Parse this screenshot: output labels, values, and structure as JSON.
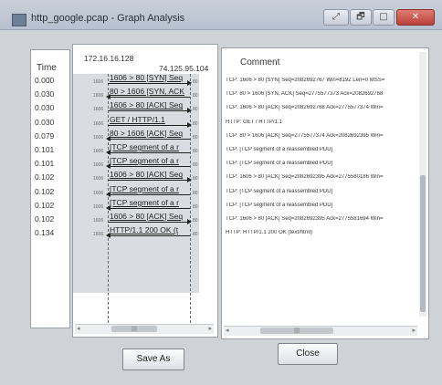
{
  "window": {
    "title": "http_google.pcap - Graph Analysis",
    "controls": [
      "⤢",
      "🗗",
      "□",
      "✕"
    ]
  },
  "time_panel": {
    "header": "Time",
    "times": [
      "0.000",
      "0.030",
      "0.030",
      "0.030",
      "0.079",
      "0.101",
      "0.101",
      "0.102",
      "0.102",
      "0.102",
      "0.102",
      "0.134"
    ]
  },
  "graph_panel": {
    "host_a": "172.16.16.128",
    "host_b": "74.125.95.104",
    "arrows": [
      {
        "label": "1606 > 80 [SYN] Seq",
        "dir": "right",
        "port_a": "1606",
        "port_b": "80"
      },
      {
        "label": "80 > 1606 [SYN, ACK",
        "dir": "left",
        "port_a": "1606",
        "port_b": "80"
      },
      {
        "label": "1606 > 80 [ACK] Seq",
        "dir": "right",
        "port_a": "1606",
        "port_b": "80"
      },
      {
        "label": "GET / HTTP/1.1",
        "dir": "right",
        "port_a": "1606",
        "port_b": "80"
      },
      {
        "label": "80 > 1606 [ACK] Seq",
        "dir": "left",
        "port_a": "1606",
        "port_b": "80"
      },
      {
        "label": "[TCP segment of a r",
        "dir": "left",
        "port_a": "1606",
        "port_b": "80"
      },
      {
        "label": "[TCP segment of a r",
        "dir": "left",
        "port_a": "1606",
        "port_b": "80"
      },
      {
        "label": "1606 > 80 [ACK] Seq",
        "dir": "right",
        "port_a": "1606",
        "port_b": "80"
      },
      {
        "label": "[TCP segment of a r",
        "dir": "left",
        "port_a": "1606",
        "port_b": "80"
      },
      {
        "label": "[TCP segment of a r",
        "dir": "left",
        "port_a": "1606",
        "port_b": "80"
      },
      {
        "label": "1606 > 80 [ACK] Seq",
        "dir": "right",
        "port_a": "1606",
        "port_b": "80"
      },
      {
        "label": "HTTP/1.1 200 OK (t",
        "dir": "left",
        "port_a": "1606",
        "port_b": "80"
      }
    ],
    "scroll_arrows": [
      "◂",
      "▸"
    ],
    "scroll_grip": "|||"
  },
  "comment_panel": {
    "header": "Comment",
    "comments": [
      "TCP: 1606 > 80 [SYN] Seq=2082692767 Win=8192 Len=0 MSS=",
      "TCP: 80 > 1606 [SYN, ACK] Seq=2775577373 Ack=2082692768",
      "TCP: 1606 > 80 [ACK] Seq=2082692768 Ack=2775577374 Win=",
      "HTTP: GET / HTTP/1.1",
      "TCP: 80 > 1606 [ACK] Seq=2775577374 Ack=2082692395 Win=",
      "TCP: [TCP segment of a reassembled PDU]",
      "TCP: [TCP segment of a reassembled PDU]",
      "TCP: 1606 > 80 [ACK] Seq=2082692395 Ack=2775580186 Win=",
      "TCP: [TCP segment of a reassembled PDU]",
      "TCP: [TCP segment of a reassembled PDU]",
      "TCP: 1606 > 80 [ACK] Seq=2082692395 Ack=2775581694 Win=",
      "HTTP: HTTP/1.1 200 OK  (text/html)"
    ],
    "scroll_arrows": [
      "◂",
      "▸"
    ],
    "scroll_grip": "|||"
  },
  "buttons": {
    "save_as": "Save As",
    "close": "Close"
  }
}
